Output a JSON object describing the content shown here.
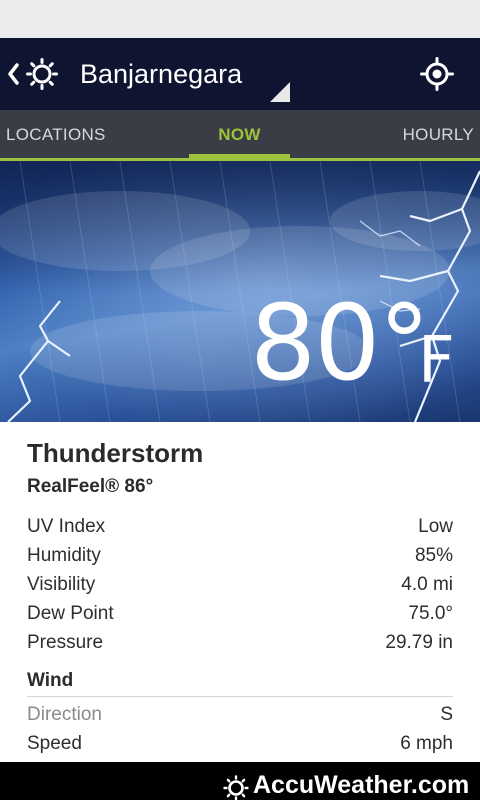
{
  "header": {
    "city": "Banjarnegara"
  },
  "tabs": [
    {
      "label": "LOCATIONS"
    },
    {
      "label": "NOW"
    },
    {
      "label": "HOURLY"
    }
  ],
  "current": {
    "temperature": "80°",
    "unit": "F",
    "condition": "Thunderstorm",
    "realfeel": "RealFeel® 86°"
  },
  "stats": [
    {
      "label": "UV Index",
      "value": "Low"
    },
    {
      "label": "Humidity",
      "value": "85%"
    },
    {
      "label": "Visibility",
      "value": "4.0 mi"
    },
    {
      "label": "Dew Point",
      "value": "75.0°"
    },
    {
      "label": "Pressure",
      "value": "29.79 in"
    }
  ],
  "wind": {
    "title": "Wind",
    "direction_label": "Direction",
    "direction_value": "S",
    "speed_label": "Speed",
    "speed_value": "6 mph"
  },
  "footer": {
    "brand": "AccuWeather.com"
  },
  "colors": {
    "header_bg": "#0f1430",
    "tab_bar_bg": "#3a3d45",
    "accent": "#9dc23b",
    "footer_bg": "#000000"
  },
  "icons": {
    "back": "chevron-left-icon",
    "app": "sun-icon",
    "dropdown": "dropdown-corner-icon",
    "locate": "gps-crosshair-icon"
  }
}
